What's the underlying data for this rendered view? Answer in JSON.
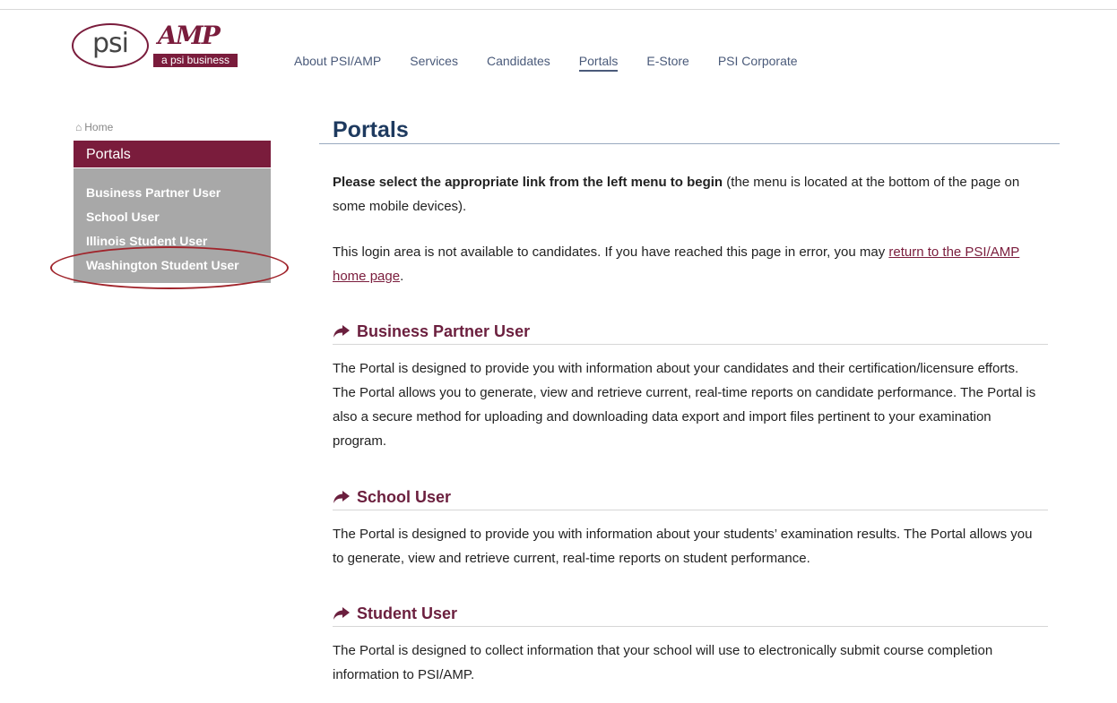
{
  "logo": {
    "psi_text": "psi",
    "amp_text": "AMP",
    "tagline": "a psi business"
  },
  "nav": {
    "items": [
      {
        "label": "About PSI/AMP"
      },
      {
        "label": "Services"
      },
      {
        "label": "Candidates"
      },
      {
        "label": "Portals",
        "active": true
      },
      {
        "label": "E-Store"
      },
      {
        "label": "PSI Corporate"
      }
    ]
  },
  "breadcrumb": {
    "icon": "home-icon",
    "label": "Home"
  },
  "sidebar": {
    "title": "Portals",
    "items": [
      {
        "label": "Business Partner User"
      },
      {
        "label": "School User"
      },
      {
        "label": "Illinois Student User"
      },
      {
        "label": "Washington Student User"
      }
    ],
    "annotation_color": "#a0242b"
  },
  "main": {
    "title": "Portals",
    "intro_bold": "Please select the appropriate link from the left menu to begin",
    "intro_rest": " (the menu is located at the bottom of the page on some mobile devices).",
    "login_text": "This login area is not available to candidates. If you have reached this page in error, you may ",
    "login_link": "return to the PSI/AMP home page",
    "login_end": ".",
    "sections": [
      {
        "icon": "share-arrow-icon",
        "heading": "Business Partner User",
        "body": "The Portal is designed to provide you with information about your candidates and their certification/licensure efforts. The Portal allows you to generate, view and retrieve current, real-time reports on candidate performance. The Portal is also a secure method for uploading and downloading data export and import files pertinent to your examination program."
      },
      {
        "icon": "share-arrow-icon",
        "heading": "School User",
        "body": "The Portal is designed to provide you with information about your students’ examination results. The Portal allows you to generate, view and retrieve current, real-time reports on student performance."
      },
      {
        "icon": "share-arrow-icon",
        "heading": "Student User",
        "body": "The Portal is designed to collect information that your school will use to electronically submit course completion information to PSI/AMP."
      }
    ]
  },
  "colors": {
    "brand": "#7a1c3c",
    "title": "#1e3a5f",
    "nav_text": "#4a5a7a",
    "sidebar_bg": "#a8a8a8"
  }
}
